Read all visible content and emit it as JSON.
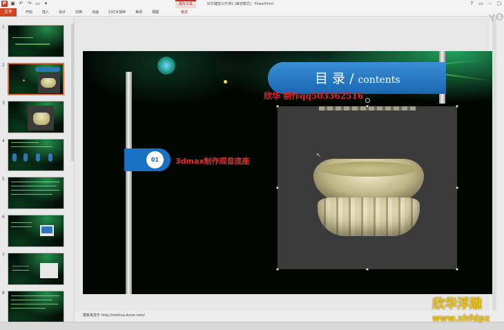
{
  "window": {
    "title": "欣华雕塑公开课1 [兼容模式] - PowerPoint",
    "tool_context_tab": "图片工具"
  },
  "ribbon": {
    "file": "文件",
    "tabs": [
      "开始",
      "插入",
      "设计",
      "切换",
      "动画",
      "幻灯片放映",
      "审阅",
      "视图"
    ],
    "format": "格式"
  },
  "thumbnails": [
    {
      "num": "1"
    },
    {
      "num": "2"
    },
    {
      "num": "3"
    },
    {
      "num": "4"
    },
    {
      "num": "5"
    },
    {
      "num": "6"
    },
    {
      "num": "7"
    },
    {
      "num": "8"
    }
  ],
  "slide": {
    "toc_title": "目 录",
    "toc_slash": " / ",
    "toc_sub": "contents",
    "credit": "欣华 制作qq503362516",
    "item_number": "01",
    "item_label": "3dmax制作观音底座"
  },
  "notes": {
    "text": "模板来自于 http://meihua.docer.com/"
  },
  "watermark": {
    "logo": "YO",
    "brand": "欣华浮雕",
    "url": "www.xhfdpx"
  },
  "colors": {
    "accent_blue": "#1a70c3",
    "file_tab": "#d04423",
    "credit_red": "#e02525",
    "watermark_yellow": "#e8c21c"
  }
}
